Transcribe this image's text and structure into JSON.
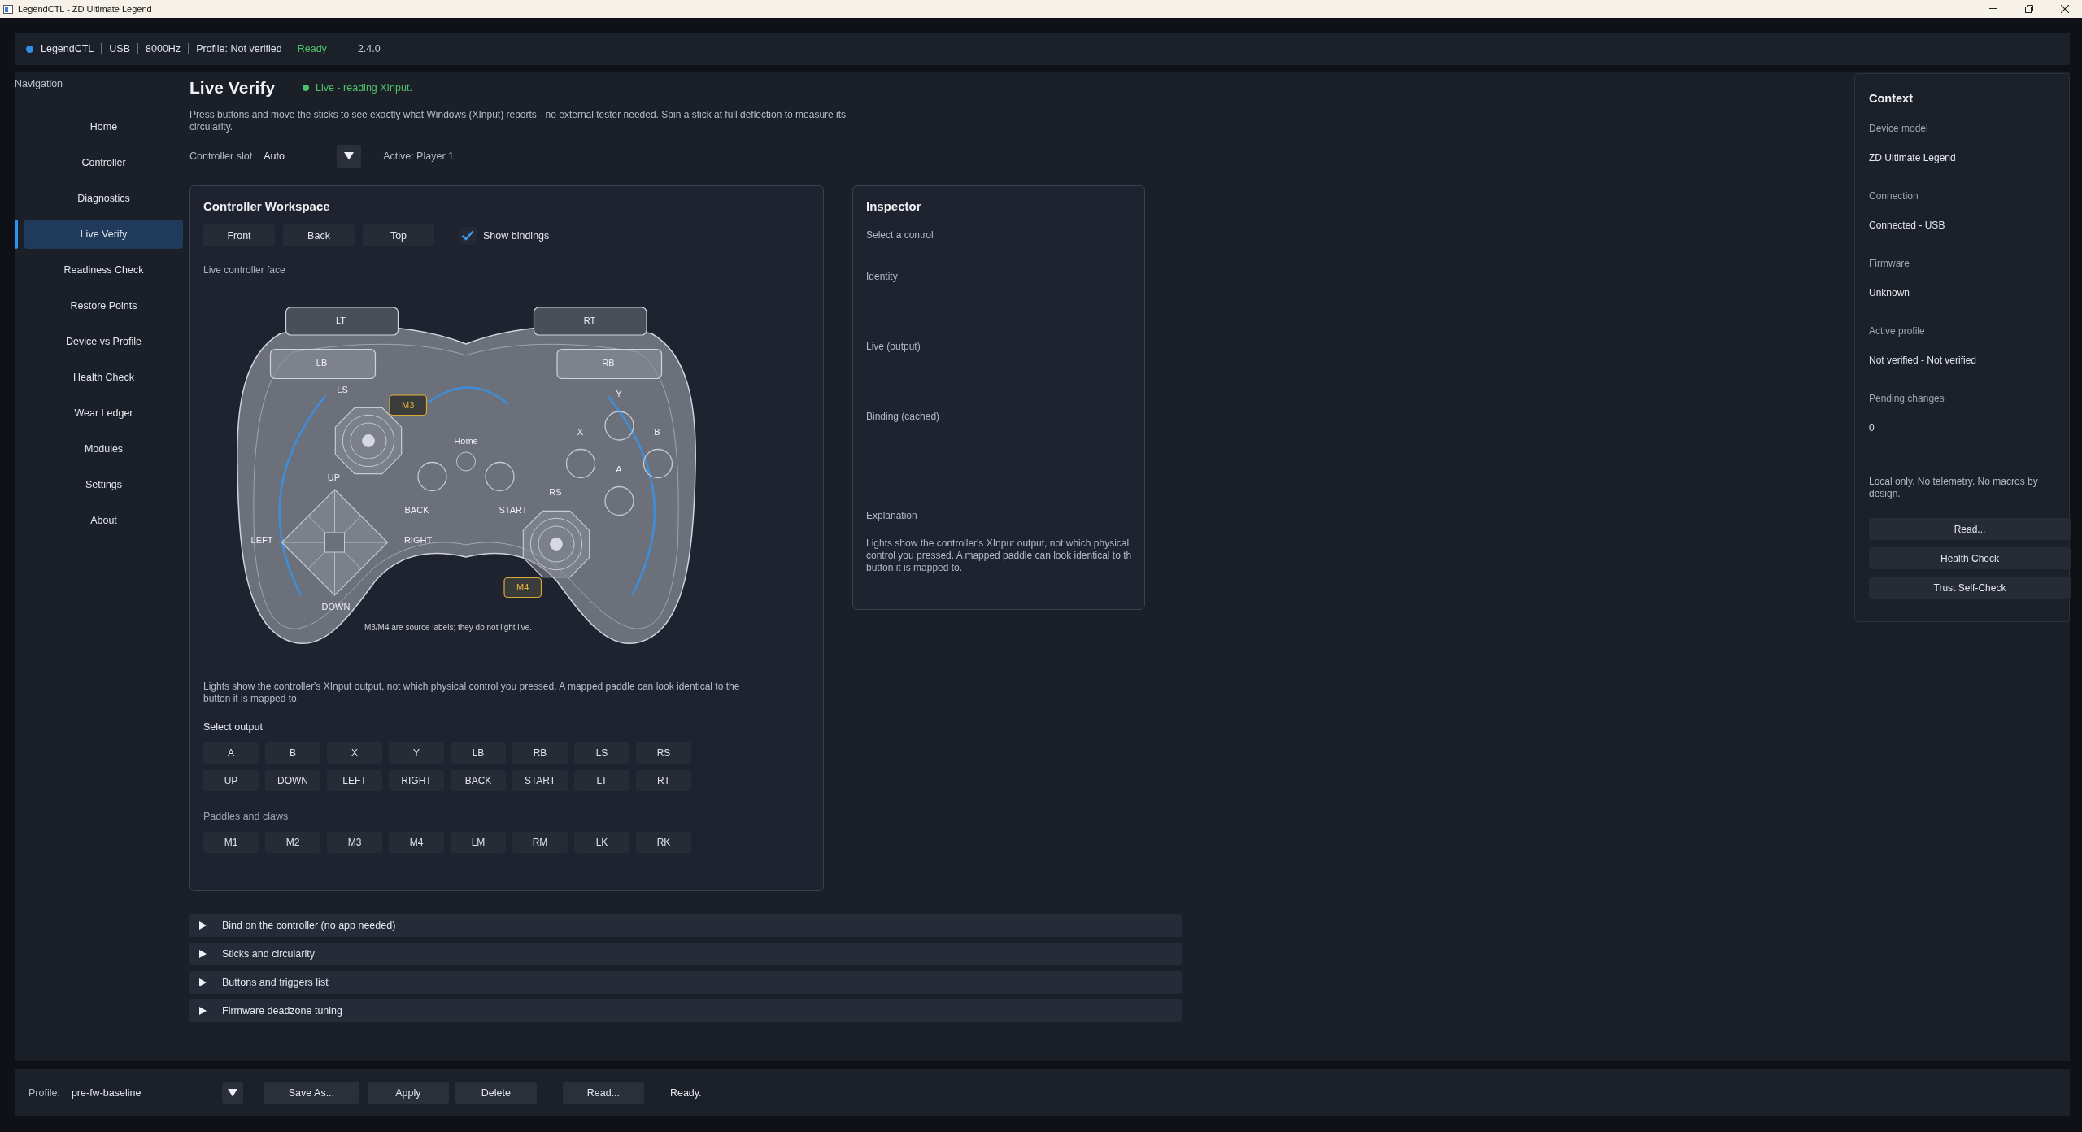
{
  "window": {
    "title": "LegendCTL - ZD Ultimate Legend"
  },
  "status_strip": {
    "connected": true,
    "items": [
      "LegendCTL",
      "USB",
      "8000Hz",
      "Profile: Not verified"
    ],
    "state": "Ready",
    "version": "2.4.0"
  },
  "navigation": {
    "title": "Navigation",
    "items": [
      {
        "label": "Home",
        "selected": false
      },
      {
        "label": "Controller",
        "selected": false
      },
      {
        "label": "Diagnostics",
        "selected": false
      },
      {
        "label": "Live Verify",
        "selected": true
      },
      {
        "label": "Readiness Check",
        "selected": false
      },
      {
        "label": "Restore Points",
        "selected": false
      },
      {
        "label": "Device vs Profile",
        "selected": false
      },
      {
        "label": "Health Check",
        "selected": false
      },
      {
        "label": "Wear Ledger",
        "selected": false
      },
      {
        "label": "Modules",
        "selected": false
      },
      {
        "label": "Settings",
        "selected": false
      },
      {
        "label": "About",
        "selected": false
      }
    ]
  },
  "page": {
    "title": "Live Verify",
    "live_status": "Live - reading XInput.",
    "description": "Press buttons and move the sticks to see exactly what Windows (XInput) reports - no external tester needed. Spin a stick at full deflection to measure its circularity.",
    "slot": {
      "label": "Controller slot",
      "value": "Auto",
      "active": "Active: Player 1"
    }
  },
  "workspace": {
    "title": "Controller Workspace",
    "views": [
      {
        "label": "Front",
        "selected": false
      },
      {
        "label": "Back",
        "selected": false
      },
      {
        "label": "Top",
        "selected": false
      }
    ],
    "show_bindings": {
      "label": "Show bindings",
      "checked": true
    },
    "face_label": "Live controller face",
    "controller": {
      "triggers": [
        "LT",
        "RT"
      ],
      "bumpers": [
        "LB",
        "RB"
      ],
      "paddle_tags": [
        "M3",
        "M4"
      ],
      "labels": [
        "LS",
        "Home",
        "X",
        "Y",
        "B",
        "A",
        "UP",
        "BACK",
        "START",
        "RS",
        "LEFT",
        "RIGHT",
        "DOWN"
      ],
      "note": "M3/M4 are source labels; they do not light live."
    },
    "explanation": "Lights show the controller's XInput output, not which physical control you pressed. A mapped paddle can look identical to the button it is mapped to.",
    "output_title": "Select output",
    "outputs": [
      "A",
      "B",
      "X",
      "Y",
      "LB",
      "RB",
      "LS",
      "RS",
      "UP",
      "DOWN",
      "LEFT",
      "RIGHT",
      "BACK",
      "START",
      "LT",
      "RT"
    ],
    "paddles_title": "Paddles and claws",
    "paddles": [
      "M1",
      "M2",
      "M3",
      "M4",
      "LM",
      "RM",
      "LK",
      "RK"
    ]
  },
  "inspector": {
    "title": "Inspector",
    "hint": "Select a control",
    "sections": [
      "Identity",
      "Live (output)",
      "Binding (cached)",
      "Explanation"
    ],
    "explanation_lines": [
      "Lights show the controller's XInput output, not which physical",
      "control you pressed. A mapped paddle can look identical to th",
      "button it is mapped to."
    ]
  },
  "context": {
    "title": "Context",
    "fields": [
      {
        "label": "Device model",
        "value": "ZD Ultimate Legend"
      },
      {
        "label": "Connection",
        "value": "Connected - USB"
      },
      {
        "label": "Firmware",
        "value": "Unknown"
      },
      {
        "label": "Active profile",
        "value": "Not verified - Not verified"
      },
      {
        "label": "Pending changes",
        "value": "0"
      }
    ],
    "note": "Local only. No telemetry. No macros by design.",
    "buttons": [
      "Read...",
      "Health Check",
      "Trust Self-Check"
    ]
  },
  "accordions": [
    {
      "label": "Bind on the controller (no app needed)",
      "expanded": false
    },
    {
      "label": "Sticks and circularity",
      "expanded": false
    },
    {
      "label": "Buttons and triggers list",
      "expanded": false
    },
    {
      "label": "Firmware deadzone tuning",
      "expanded": false
    }
  ],
  "bottom_bar": {
    "profile_label": "Profile:",
    "profile_value": "pre-fw-baseline",
    "buttons": [
      "Save As...",
      "Apply",
      "Delete",
      "Read..."
    ],
    "status": "Ready."
  }
}
